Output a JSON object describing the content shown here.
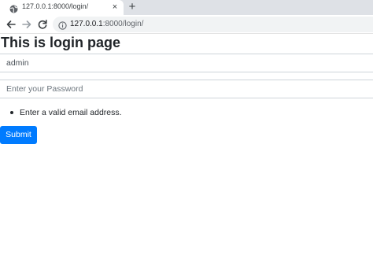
{
  "browser": {
    "tab": {
      "title": "127.0.0.1:8000/login/",
      "close_glyph": "×",
      "favicon": "globe-icon"
    },
    "new_tab_glyph": "+",
    "address_bar": {
      "host": "127.0.0.1",
      "path": ":8000/login/",
      "info_icon": "info-icon"
    },
    "nav": {
      "back_icon": "arrow-left-icon",
      "forward_icon": "arrow-right-icon",
      "reload_icon": "reload-icon"
    }
  },
  "page": {
    "heading": "This is login page",
    "form": {
      "username_value": "admin",
      "password_placeholder": "Enter your Password",
      "errors": [
        "Enter a valid email address."
      ],
      "submit_label": "Submit"
    }
  },
  "colors": {
    "primary": "#007bff",
    "tabbar_bg": "#dee1e6",
    "omnibox_bg": "#f1f3f4"
  }
}
